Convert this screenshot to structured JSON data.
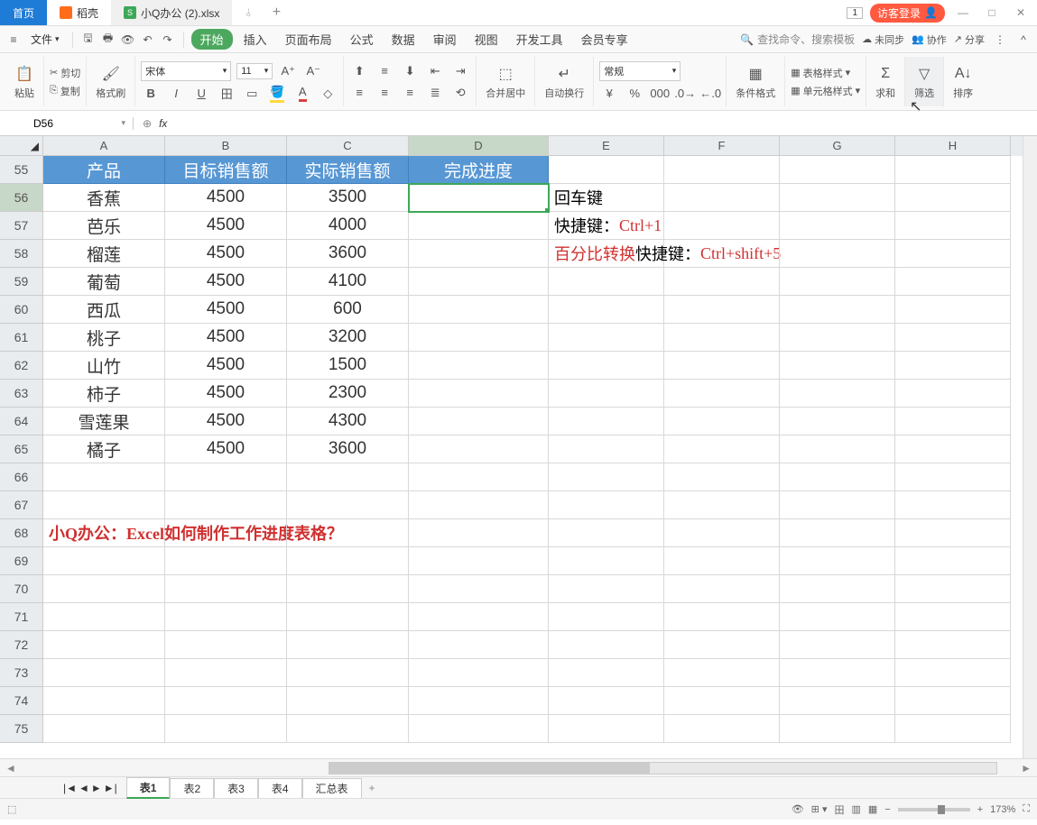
{
  "titlebar": {
    "home": "首页",
    "daoke": "稻壳",
    "filename": "小Q办公 (2).xlsx",
    "badge": "1",
    "login": "访客登录"
  },
  "menubar": {
    "file": "文件",
    "items": [
      "开始",
      "插入",
      "页面布局",
      "公式",
      "数据",
      "审阅",
      "视图",
      "开发工具",
      "会员专享"
    ],
    "search_placeholder": "查找命令、搜索模板",
    "unsync": "未同步",
    "collab": "协作",
    "share": "分享"
  },
  "ribbon": {
    "paste": "粘贴",
    "cut": "剪切",
    "copy": "复制",
    "brush": "格式刷",
    "font_name": "宋体",
    "font_size": "11",
    "merge": "合并居中",
    "wrap": "自动换行",
    "numfmt": "常规",
    "cond": "条件格式",
    "tablefmt": "表格样式",
    "cellfmt": "单元格样式",
    "sum": "求和",
    "filter": "筛选",
    "sort": "排序"
  },
  "formula": {
    "cellref": "D56"
  },
  "columns": [
    "A",
    "B",
    "C",
    "D",
    "E",
    "F",
    "G",
    "H"
  ],
  "headers": {
    "a": "产品",
    "b": "目标销售额",
    "c": "实际销售额",
    "d": "完成进度"
  },
  "rows": [
    {
      "n": "55",
      "a": "",
      "b": "",
      "c": "",
      "hdr": true
    },
    {
      "n": "56",
      "a": "香蕉",
      "b": "4500",
      "c": "3500"
    },
    {
      "n": "57",
      "a": "芭乐",
      "b": "4500",
      "c": "4000"
    },
    {
      "n": "58",
      "a": "榴莲",
      "b": "4500",
      "c": "3600"
    },
    {
      "n": "59",
      "a": "葡萄",
      "b": "4500",
      "c": "4100"
    },
    {
      "n": "60",
      "a": "西瓜",
      "b": "4500",
      "c": "600"
    },
    {
      "n": "61",
      "a": "桃子",
      "b": "4500",
      "c": "3200"
    },
    {
      "n": "62",
      "a": "山竹",
      "b": "4500",
      "c": "1500"
    },
    {
      "n": "63",
      "a": "柿子",
      "b": "4500",
      "c": "2300"
    },
    {
      "n": "64",
      "a": "雪莲果",
      "b": "4500",
      "c": "4300"
    },
    {
      "n": "65",
      "a": "橘子",
      "b": "4500",
      "c": "3600"
    },
    {
      "n": "66"
    },
    {
      "n": "67"
    },
    {
      "n": "68"
    },
    {
      "n": "69"
    },
    {
      "n": "70"
    },
    {
      "n": "71"
    },
    {
      "n": "72"
    },
    {
      "n": "73"
    },
    {
      "n": "74"
    },
    {
      "n": "75"
    }
  ],
  "notes": {
    "e56": "回车键",
    "e57_label": "快捷键：",
    "e57_val": "Ctrl+1",
    "e58_red": "百分比转换",
    "e58_label": "快捷键：",
    "e58_val": "Ctrl+shift+5",
    "a68": "小Q办公：Excel如何制作工作进度表格？"
  },
  "sheets": {
    "tabs": [
      "表1",
      "表2",
      "表3",
      "表4",
      "汇总表"
    ]
  },
  "status": {
    "zoom": "173%"
  }
}
